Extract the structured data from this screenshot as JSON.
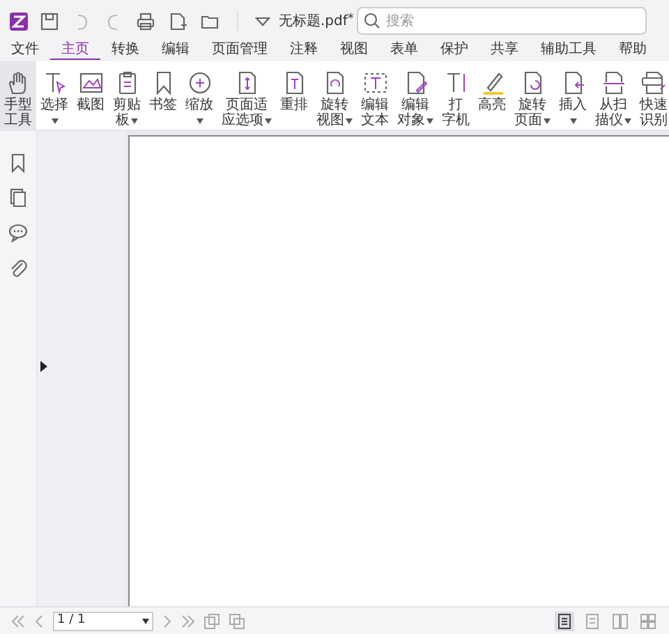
{
  "title_bar": {
    "document": "无标题.pdf",
    "modified_mark": "*",
    "search": {
      "placeholder": "搜索"
    }
  },
  "menu": [
    {
      "label": "文件",
      "selected": false
    },
    {
      "label": "主页",
      "selected": true
    },
    {
      "label": "转换",
      "selected": false
    },
    {
      "label": "编辑",
      "selected": false
    },
    {
      "label": "页面管理",
      "selected": false
    },
    {
      "label": "注释",
      "selected": false
    },
    {
      "label": "视图",
      "selected": false
    },
    {
      "label": "表单",
      "selected": false
    },
    {
      "label": "保护",
      "selected": false
    },
    {
      "label": "共享",
      "selected": false
    },
    {
      "label": "辅助工具",
      "selected": false
    },
    {
      "label": "帮助",
      "selected": false
    }
  ],
  "ribbon": [
    [
      {
        "kind": "hand",
        "lines": [
          "手型",
          "工具"
        ],
        "dropdown": false,
        "selected": true
      },
      {
        "kind": "select",
        "lines": [
          "选择"
        ],
        "dropdown": true,
        "selected": false
      },
      {
        "kind": "snapshot",
        "lines": [
          "截图"
        ],
        "dropdown": false,
        "selected": false
      },
      {
        "kind": "clipboard",
        "lines": [
          "剪贴",
          "板"
        ],
        "dropdown": true,
        "selected": false
      },
      {
        "kind": "bookmark",
        "lines": [
          "书签"
        ],
        "dropdown": false,
        "selected": false
      }
    ],
    [
      {
        "kind": "zoom",
        "lines": [
          "缩放"
        ],
        "dropdown": true,
        "selected": false
      },
      {
        "kind": "fit",
        "lines": [
          "页面适",
          "应选项"
        ],
        "dropdown": true,
        "selected": false
      },
      {
        "kind": "reflow",
        "lines": [
          "重排"
        ],
        "dropdown": false,
        "selected": false
      },
      {
        "kind": "rotate",
        "lines": [
          "旋转",
          "视图"
        ],
        "dropdown": true,
        "selected": false
      }
    ],
    [
      {
        "kind": "edit_text",
        "lines": [
          "编辑",
          "文本"
        ],
        "dropdown": false,
        "selected": false
      },
      {
        "kind": "edit_object",
        "lines": [
          "编辑",
          "对象"
        ],
        "dropdown": true,
        "selected": false
      }
    ],
    [
      {
        "kind": "typewriter",
        "lines": [
          "打",
          "字机"
        ],
        "dropdown": false,
        "selected": false
      },
      {
        "kind": "highlight",
        "lines": [
          "高亮"
        ],
        "dropdown": false,
        "selected": false
      }
    ],
    [
      {
        "kind": "rotate_page",
        "lines": [
          "旋转",
          "页面"
        ],
        "dropdown": true,
        "selected": false
      },
      {
        "kind": "insert",
        "lines": [
          "插入"
        ],
        "dropdown": true,
        "selected": false
      }
    ],
    [
      {
        "kind": "scan",
        "lines": [
          "从扫",
          "描仪"
        ],
        "dropdown": true,
        "selected": false
      },
      {
        "kind": "ocr",
        "lines": [
          "快速",
          "识别"
        ],
        "dropdown": false,
        "selected": false
      }
    ]
  ],
  "status_bar": {
    "page_field": {
      "value": "1 / 1"
    },
    "views": [
      {
        "selected": true
      },
      {
        "selected": false
      },
      {
        "selected": false
      },
      {
        "selected": false
      }
    ]
  }
}
